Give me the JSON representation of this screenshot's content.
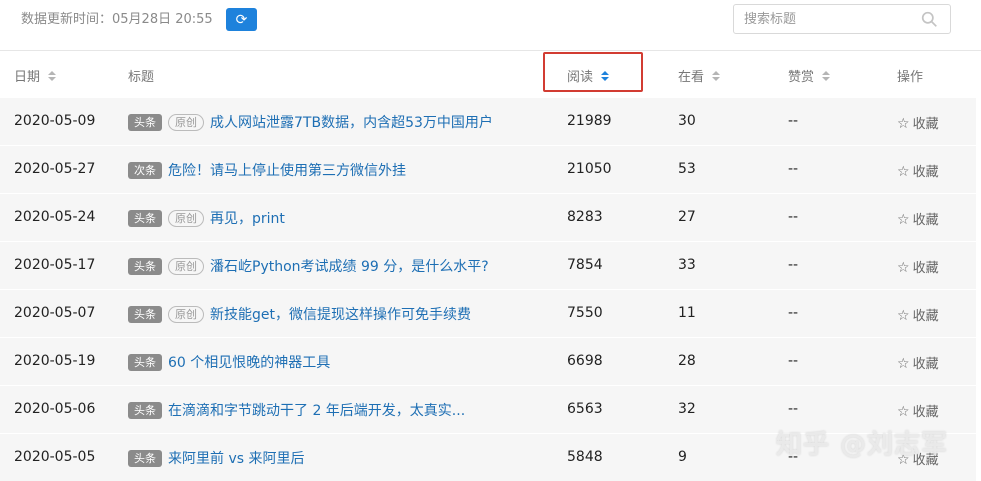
{
  "header": {
    "update_label": "数据更新时间：05月28日 20:55",
    "search_placeholder": "搜索标题"
  },
  "columns": {
    "date": "日期",
    "title": "标题",
    "reads": "阅读",
    "watching": "在看",
    "rewards": "赞赏",
    "actions": "操作"
  },
  "rows": [
    {
      "date": "2020-05-09",
      "tag": "头条",
      "original": "原创",
      "title": "成人网站泄露7TB数据，内含超53万中国用户",
      "reads": "21989",
      "watching": "30",
      "rewards": "--",
      "action": "收藏"
    },
    {
      "date": "2020-05-27",
      "tag": "次条",
      "original": "",
      "title": "危险！请马上停止使用第三方微信外挂",
      "reads": "21050",
      "watching": "53",
      "rewards": "--",
      "action": "收藏"
    },
    {
      "date": "2020-05-24",
      "tag": "头条",
      "original": "原创",
      "title": "再见，print",
      "reads": "8283",
      "watching": "27",
      "rewards": "--",
      "action": "收藏"
    },
    {
      "date": "2020-05-17",
      "tag": "头条",
      "original": "原创",
      "title": "潘石屹Python考试成绩 99 分，是什么水平?",
      "reads": "7854",
      "watching": "33",
      "rewards": "--",
      "action": "收藏"
    },
    {
      "date": "2020-05-07",
      "tag": "头条",
      "original": "原创",
      "title": "新技能get，微信提现这样操作可免手续费",
      "reads": "7550",
      "watching": "11",
      "rewards": "--",
      "action": "收藏"
    },
    {
      "date": "2020-05-19",
      "tag": "头条",
      "original": "",
      "title": "60 个相见恨晚的神器工具",
      "reads": "6698",
      "watching": "28",
      "rewards": "--",
      "action": "收藏"
    },
    {
      "date": "2020-05-06",
      "tag": "头条",
      "original": "",
      "title": "在滴滴和字节跳动干了 2 年后端开发，太真实...",
      "reads": "6563",
      "watching": "32",
      "rewards": "--",
      "action": "收藏"
    },
    {
      "date": "2020-05-05",
      "tag": "头条",
      "original": "",
      "title": "来阿里前 vs 来阿里后",
      "reads": "5848",
      "watching": "9",
      "rewards": "--",
      "action": "收藏"
    }
  ],
  "watermark": "知乎 @刘志军"
}
